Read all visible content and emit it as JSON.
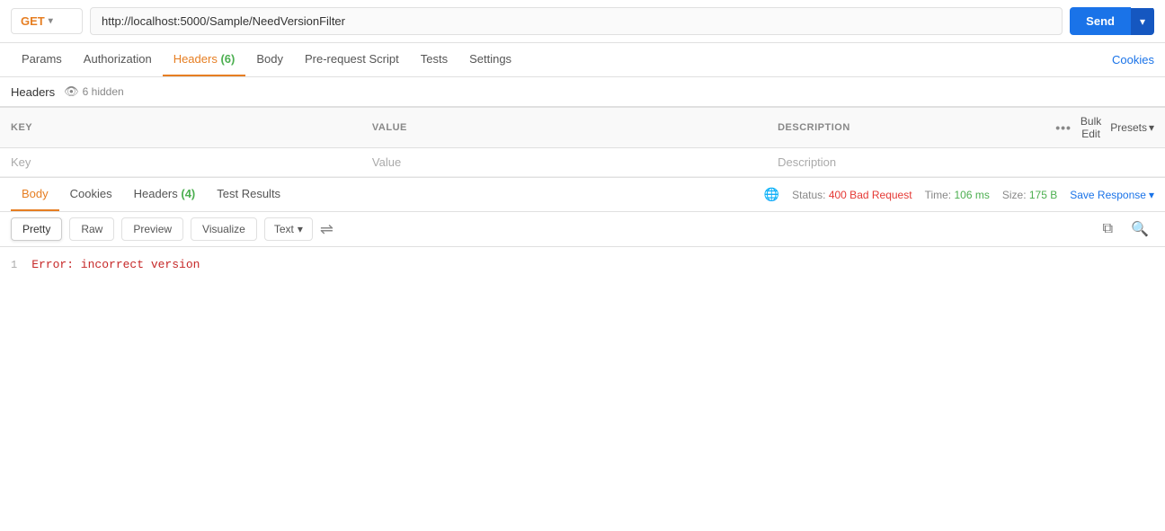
{
  "topbar": {
    "method": "GET",
    "method_chevron": "▾",
    "url": "http://localhost:5000/Sample/NeedVersionFilter",
    "send_label": "Send",
    "send_arrow": "▾"
  },
  "request_tabs": {
    "items": [
      {
        "id": "params",
        "label": "Params",
        "badge": null,
        "active": false
      },
      {
        "id": "authorization",
        "label": "Authorization",
        "badge": null,
        "active": false
      },
      {
        "id": "headers",
        "label": "Headers",
        "badge": "6",
        "active": true
      },
      {
        "id": "body",
        "label": "Body",
        "badge": null,
        "active": false
      },
      {
        "id": "prerequest",
        "label": "Pre-request Script",
        "badge": null,
        "active": false
      },
      {
        "id": "tests",
        "label": "Tests",
        "badge": null,
        "active": false
      },
      {
        "id": "settings",
        "label": "Settings",
        "badge": null,
        "active": false
      }
    ],
    "cookies_link": "Cookies"
  },
  "headers_panel": {
    "label": "Headers",
    "hidden_count": "6 hidden",
    "columns": {
      "key": "KEY",
      "value": "VALUE",
      "description": "DESCRIPTION"
    },
    "bulk_edit": "Bulk Edit",
    "presets": "Presets",
    "presets_chevron": "▾",
    "placeholder_row": {
      "key": "Key",
      "value": "Value",
      "description": "Description"
    }
  },
  "response_tabs": {
    "items": [
      {
        "id": "body",
        "label": "Body",
        "badge": null,
        "active": true
      },
      {
        "id": "cookies",
        "label": "Cookies",
        "badge": null,
        "active": false
      },
      {
        "id": "headers",
        "label": "Headers",
        "badge": "4",
        "active": false
      },
      {
        "id": "test_results",
        "label": "Test Results",
        "badge": null,
        "active": false
      }
    ],
    "status": {
      "icon": "🌐",
      "label_status": "Status:",
      "value_status": "400 Bad Request",
      "label_time": "Time:",
      "value_time": "106 ms",
      "label_size": "Size:",
      "value_size": "175 B"
    },
    "save_response": "Save Response",
    "save_chevron": "▾"
  },
  "response_toolbar": {
    "format_buttons": [
      "Pretty",
      "Raw",
      "Preview",
      "Visualize"
    ],
    "active_format": "Pretty",
    "text_label": "Text",
    "text_chevron": "▾",
    "wrap_icon": "≡"
  },
  "response_content": {
    "lines": [
      {
        "number": "1",
        "text": "Error: incorrect version"
      }
    ]
  }
}
